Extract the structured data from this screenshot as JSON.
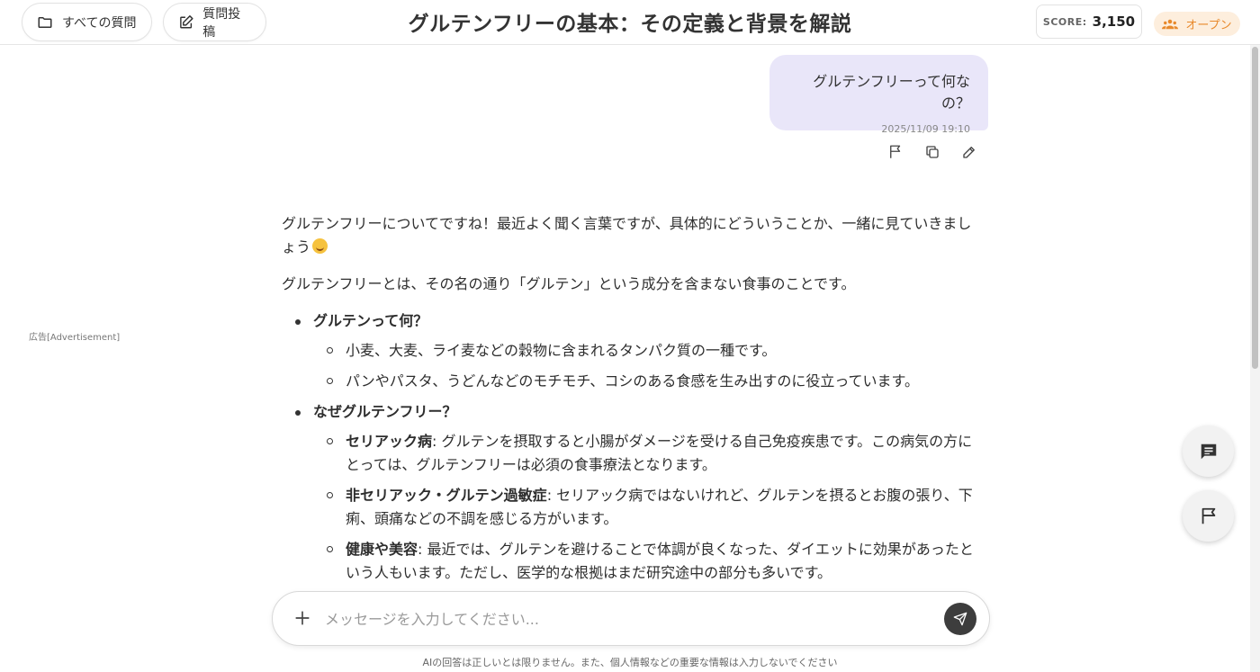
{
  "header": {
    "all_questions_label": "すべての質問",
    "post_question_label": "質問投稿",
    "title": "グルテンフリーの基本：その定義と背景を解説",
    "score_label": "SCORE:",
    "score_value": "3,150",
    "status_label": "オープン"
  },
  "ad_label": "広告[Advertisement]",
  "user_message": {
    "text": "グルテンフリーって何なの？",
    "timestamp": "2025/11/09 19:10"
  },
  "answer": {
    "intro": "グルテンフリーについてですね！最近よく聞く言葉ですが、具体的にどういうことか、一緒に見ていきましょう",
    "definition": "グルテンフリーとは、その名の通り「グルテン」という成分を含まない食事のことです。",
    "sections": [
      {
        "heading": "グルテンって何？",
        "items": [
          {
            "term": "",
            "text": "小麦、大麦、ライ麦などの穀物に含まれるタンパク質の一種です。"
          },
          {
            "term": "",
            "text": "パンやパスタ、うどんなどのモチモチ、コシのある食感を生み出すのに役立っています。"
          }
        ]
      },
      {
        "heading": "なぜグルテンフリー？",
        "items": [
          {
            "term": "セリアック病",
            "text": ": グルテンを摂取すると小腸がダメージを受ける自己免疫疾患です。この病気の方にとっては、グルテンフリーは必須の食事療法となります。"
          },
          {
            "term": "非セリアック・グルテン過敏症",
            "text": ": セリアック病ではないけれど、グルテンを摂るとお腹の張り、下痢、頭痛などの不調を感じる方がいます。"
          },
          {
            "term": "健康や美容",
            "text": ": 最近では、グルテンを避けることで体調が良くなった、ダイエットに効果があったという人もいます。ただし、医学的な根拠はまだ研究途中の部分も多いです。"
          }
        ]
      }
    ]
  },
  "input": {
    "placeholder": "メッセージを入力してください...",
    "value": ""
  },
  "disclaimer": "AIの回答は正しいとは限りません。また、個人情報などの重要な情報は入力しないでください",
  "icons": {
    "folder": "folder-icon",
    "edit": "edit-icon",
    "users": "users-icon",
    "flag": "flag-icon",
    "copy": "copy-icon",
    "pencil": "pencil-icon",
    "chat": "chat-icon",
    "plus": "plus-icon",
    "send": "send-icon",
    "emoji": "smiling-face-emoji"
  },
  "colors": {
    "user_bubble": "#e9e6f9",
    "status_badge_bg": "#fdeedd",
    "status_badge_text": "#e8892b",
    "send_button": "#3d3d3d"
  }
}
